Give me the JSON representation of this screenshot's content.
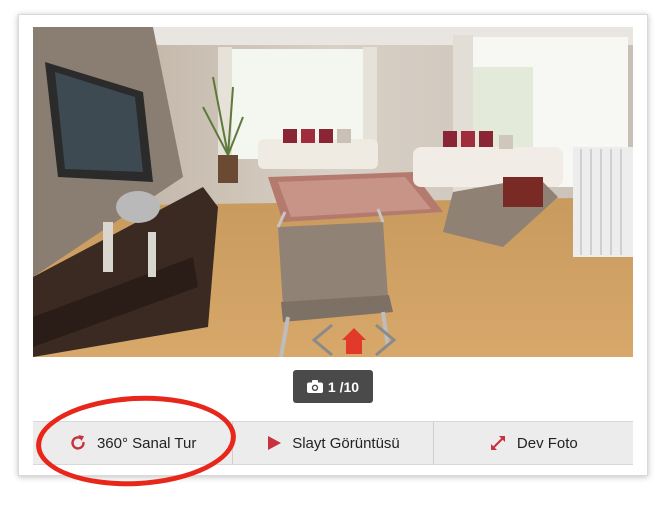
{
  "gallery": {
    "photo_alt": "Living room interior",
    "counter_text": "1 /10",
    "counter_icon": "camera-icon"
  },
  "actions": [
    {
      "label": "360° Sanal Tur",
      "icon": "refresh-icon"
    },
    {
      "label": "Slayt Görüntüsü",
      "icon": "play-icon"
    },
    {
      "label": "Dev Foto",
      "icon": "expand-icon"
    }
  ],
  "colors": {
    "accent": "#c8313f",
    "highlight": "#e8261a",
    "counter_bg": "#4a4a4a",
    "action_bar_bg": "#ececec"
  }
}
